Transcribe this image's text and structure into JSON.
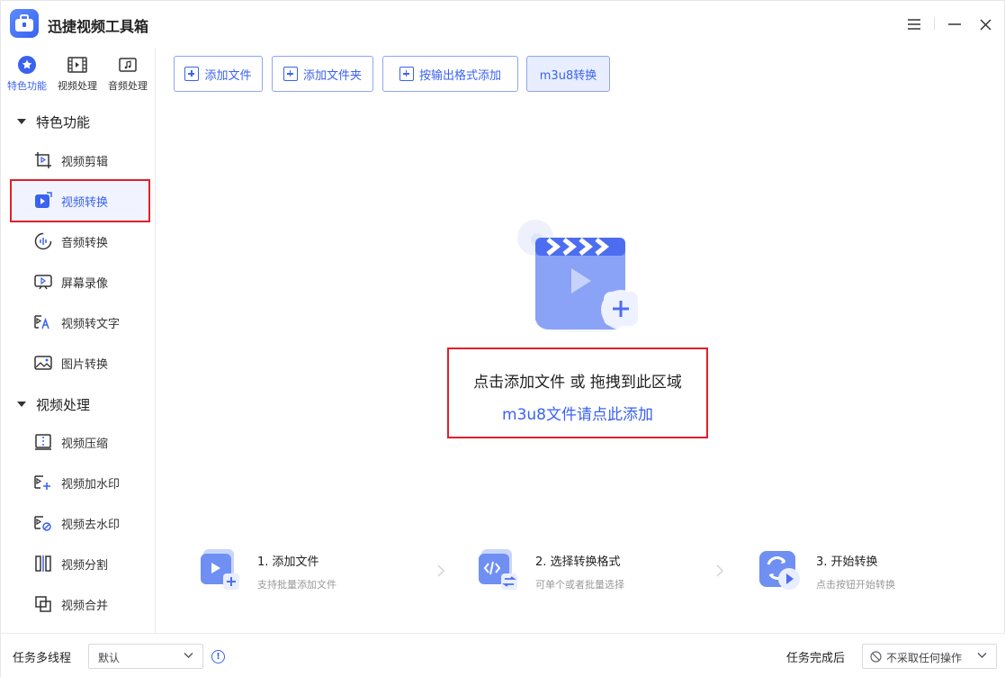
{
  "app": {
    "title": "迅捷视频工具箱",
    "accent": "#3a62f0",
    "highlight": "#e0202a"
  },
  "window_controls": [
    "menu-icon",
    "minimize-icon",
    "close-icon"
  ],
  "sidebar": {
    "category_tabs": [
      {
        "label": "特色功能",
        "icon": "star-icon",
        "active": true
      },
      {
        "label": "视频处理",
        "icon": "film-icon",
        "active": false
      },
      {
        "label": "音频处理",
        "icon": "music-icon",
        "active": false
      }
    ],
    "groups": [
      {
        "label": "特色功能",
        "items": [
          {
            "label": "视频剪辑",
            "icon": "crop-video-icon"
          },
          {
            "label": "视频转换",
            "icon": "video-convert-icon",
            "active": true
          },
          {
            "label": "音频转换",
            "icon": "audio-wave-icon"
          },
          {
            "label": "屏幕录像",
            "icon": "screen-record-icon"
          },
          {
            "label": "视频转文字",
            "icon": "video-to-text-icon"
          },
          {
            "label": "图片转换",
            "icon": "image-icon"
          }
        ]
      },
      {
        "label": "视频处理",
        "items": [
          {
            "label": "视频压缩",
            "icon": "compress-icon"
          },
          {
            "label": "视频加水印",
            "icon": "add-watermark-icon"
          },
          {
            "label": "视频去水印",
            "icon": "remove-watermark-icon"
          },
          {
            "label": "视频分割",
            "icon": "split-icon"
          },
          {
            "label": "视频合并",
            "icon": "merge-icon"
          }
        ]
      }
    ]
  },
  "toolbar": {
    "add_file": "添加文件",
    "add_folder": "添加文件夹",
    "add_by_format": "按输出格式添加",
    "m3u8": "m3u8转换"
  },
  "dropzone": {
    "main": "点击添加文件 或 拖拽到此区域",
    "sub": "m3u8文件请点此添加"
  },
  "steps": [
    {
      "title": "1. 添加文件",
      "desc": "支持批量添加文件"
    },
    {
      "title": "2. 选择转换格式",
      "desc": "可单个或者批量选择"
    },
    {
      "title": "3. 开始转换",
      "desc": "点击按钮开始转换"
    }
  ],
  "footer": {
    "threads_label": "任务多线程",
    "threads_value": "默认",
    "after_label": "任务完成后",
    "after_value": "不采取任何操作"
  }
}
